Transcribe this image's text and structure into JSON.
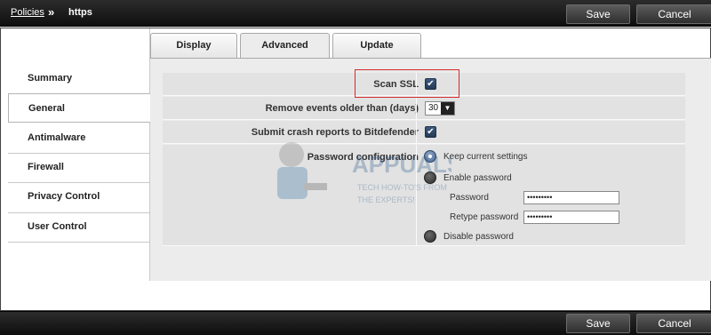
{
  "breadcrumb": {
    "root": "Policies",
    "separator": "»",
    "current": "https"
  },
  "actions": {
    "save": "Save",
    "cancel": "Cancel"
  },
  "sidebar": {
    "items": [
      {
        "label": "Summary"
      },
      {
        "label": "General",
        "active": true
      },
      {
        "label": "Antimalware"
      },
      {
        "label": "Firewall"
      },
      {
        "label": "Privacy Control"
      },
      {
        "label": "User Control"
      }
    ]
  },
  "tabs": [
    {
      "label": "Display"
    },
    {
      "label": "Advanced",
      "active": true
    },
    {
      "label": "Update"
    }
  ],
  "settings": {
    "scan_ssl": {
      "label": "Scan SSL",
      "checked": true
    },
    "remove_events": {
      "label": "Remove events older than (days)",
      "value": "30"
    },
    "crash_reports": {
      "label": "Submit crash reports to Bitdefender",
      "checked": true
    },
    "password_config": {
      "label": "Password configuration",
      "options": [
        "Keep current settings",
        "Enable password",
        "Disable password"
      ],
      "selected": "Keep current settings",
      "password_label": "Password",
      "password_value": "•••••••••",
      "retype_label": "Retype password",
      "retype_value": "•••••••••"
    }
  },
  "watermark": {
    "brand": "APPUALS",
    "tagline_1": "TECH HOW-TO'S FROM",
    "tagline_2": "THE EXPERTS!"
  },
  "colors": {
    "highlight": "#d22b2b",
    "checkbox": "#2f4a6b",
    "topbar": "#1a1a1a"
  }
}
